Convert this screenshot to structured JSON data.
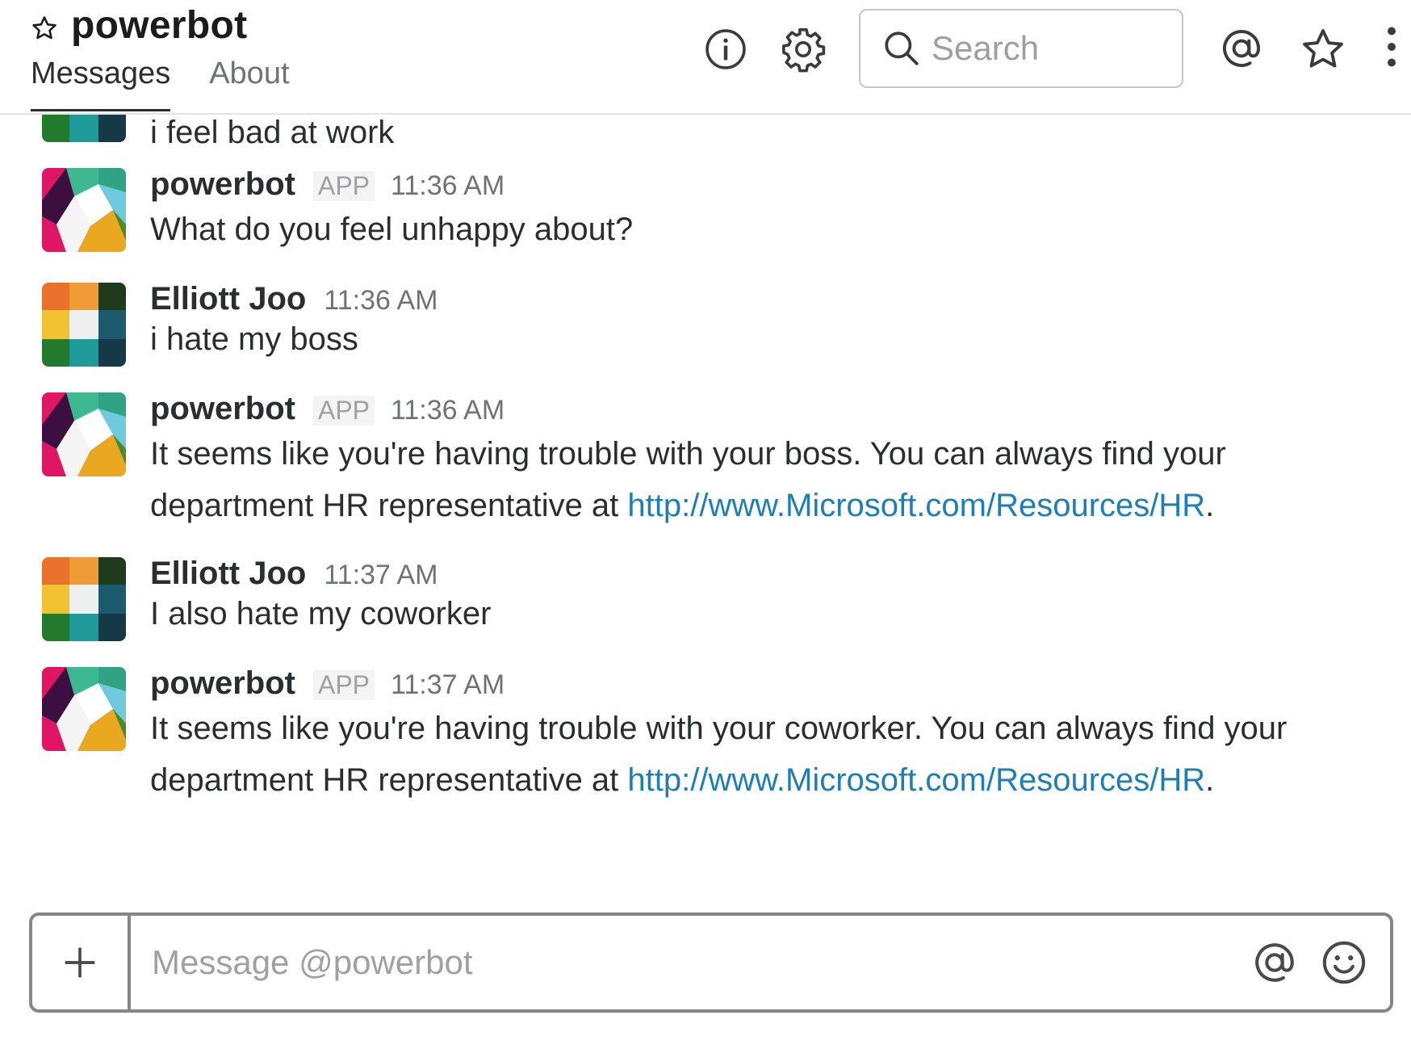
{
  "channel": {
    "name": "powerbot",
    "tabs": [
      {
        "label": "Messages",
        "active": true
      },
      {
        "label": "About",
        "active": false
      }
    ]
  },
  "header_icons": [
    "star-icon",
    "info-icon",
    "gear-icon",
    "search-icon",
    "mention-icon",
    "starred-items-icon",
    "more-vertical-icon"
  ],
  "search": {
    "placeholder": "Search"
  },
  "messages": [
    {
      "author": "",
      "text": "i feel bad at work",
      "continued": true
    },
    {
      "author": "powerbot",
      "app_badge": "APP",
      "time": "11:36 AM",
      "text": "What do you feel unhappy about?"
    },
    {
      "author": "Elliott Joo",
      "time": "11:36 AM",
      "text": "i hate my boss"
    },
    {
      "author": "powerbot",
      "app_badge": "APP",
      "time": "11:36 AM",
      "text": "It seems like you're having trouble with your boss. You can always find your department HR representative at ",
      "link": "http://www.Microsoft.com/Resources/HR",
      "suffix": "."
    },
    {
      "author": "Elliott Joo",
      "time": "11:37 AM",
      "text": "I also hate my coworker"
    },
    {
      "author": "powerbot",
      "app_badge": "APP",
      "time": "11:37 AM",
      "text": "It seems like you're having trouble with your coworker. You can always find your department HR representative at ",
      "link": "http://www.Microsoft.com/Resources/HR",
      "suffix": "."
    }
  ],
  "composer": {
    "placeholder": "Message @powerbot"
  },
  "colors": {
    "link": "#1f7fb5",
    "text": "#2c2d30",
    "muted": "#717274",
    "border": "#868686"
  }
}
